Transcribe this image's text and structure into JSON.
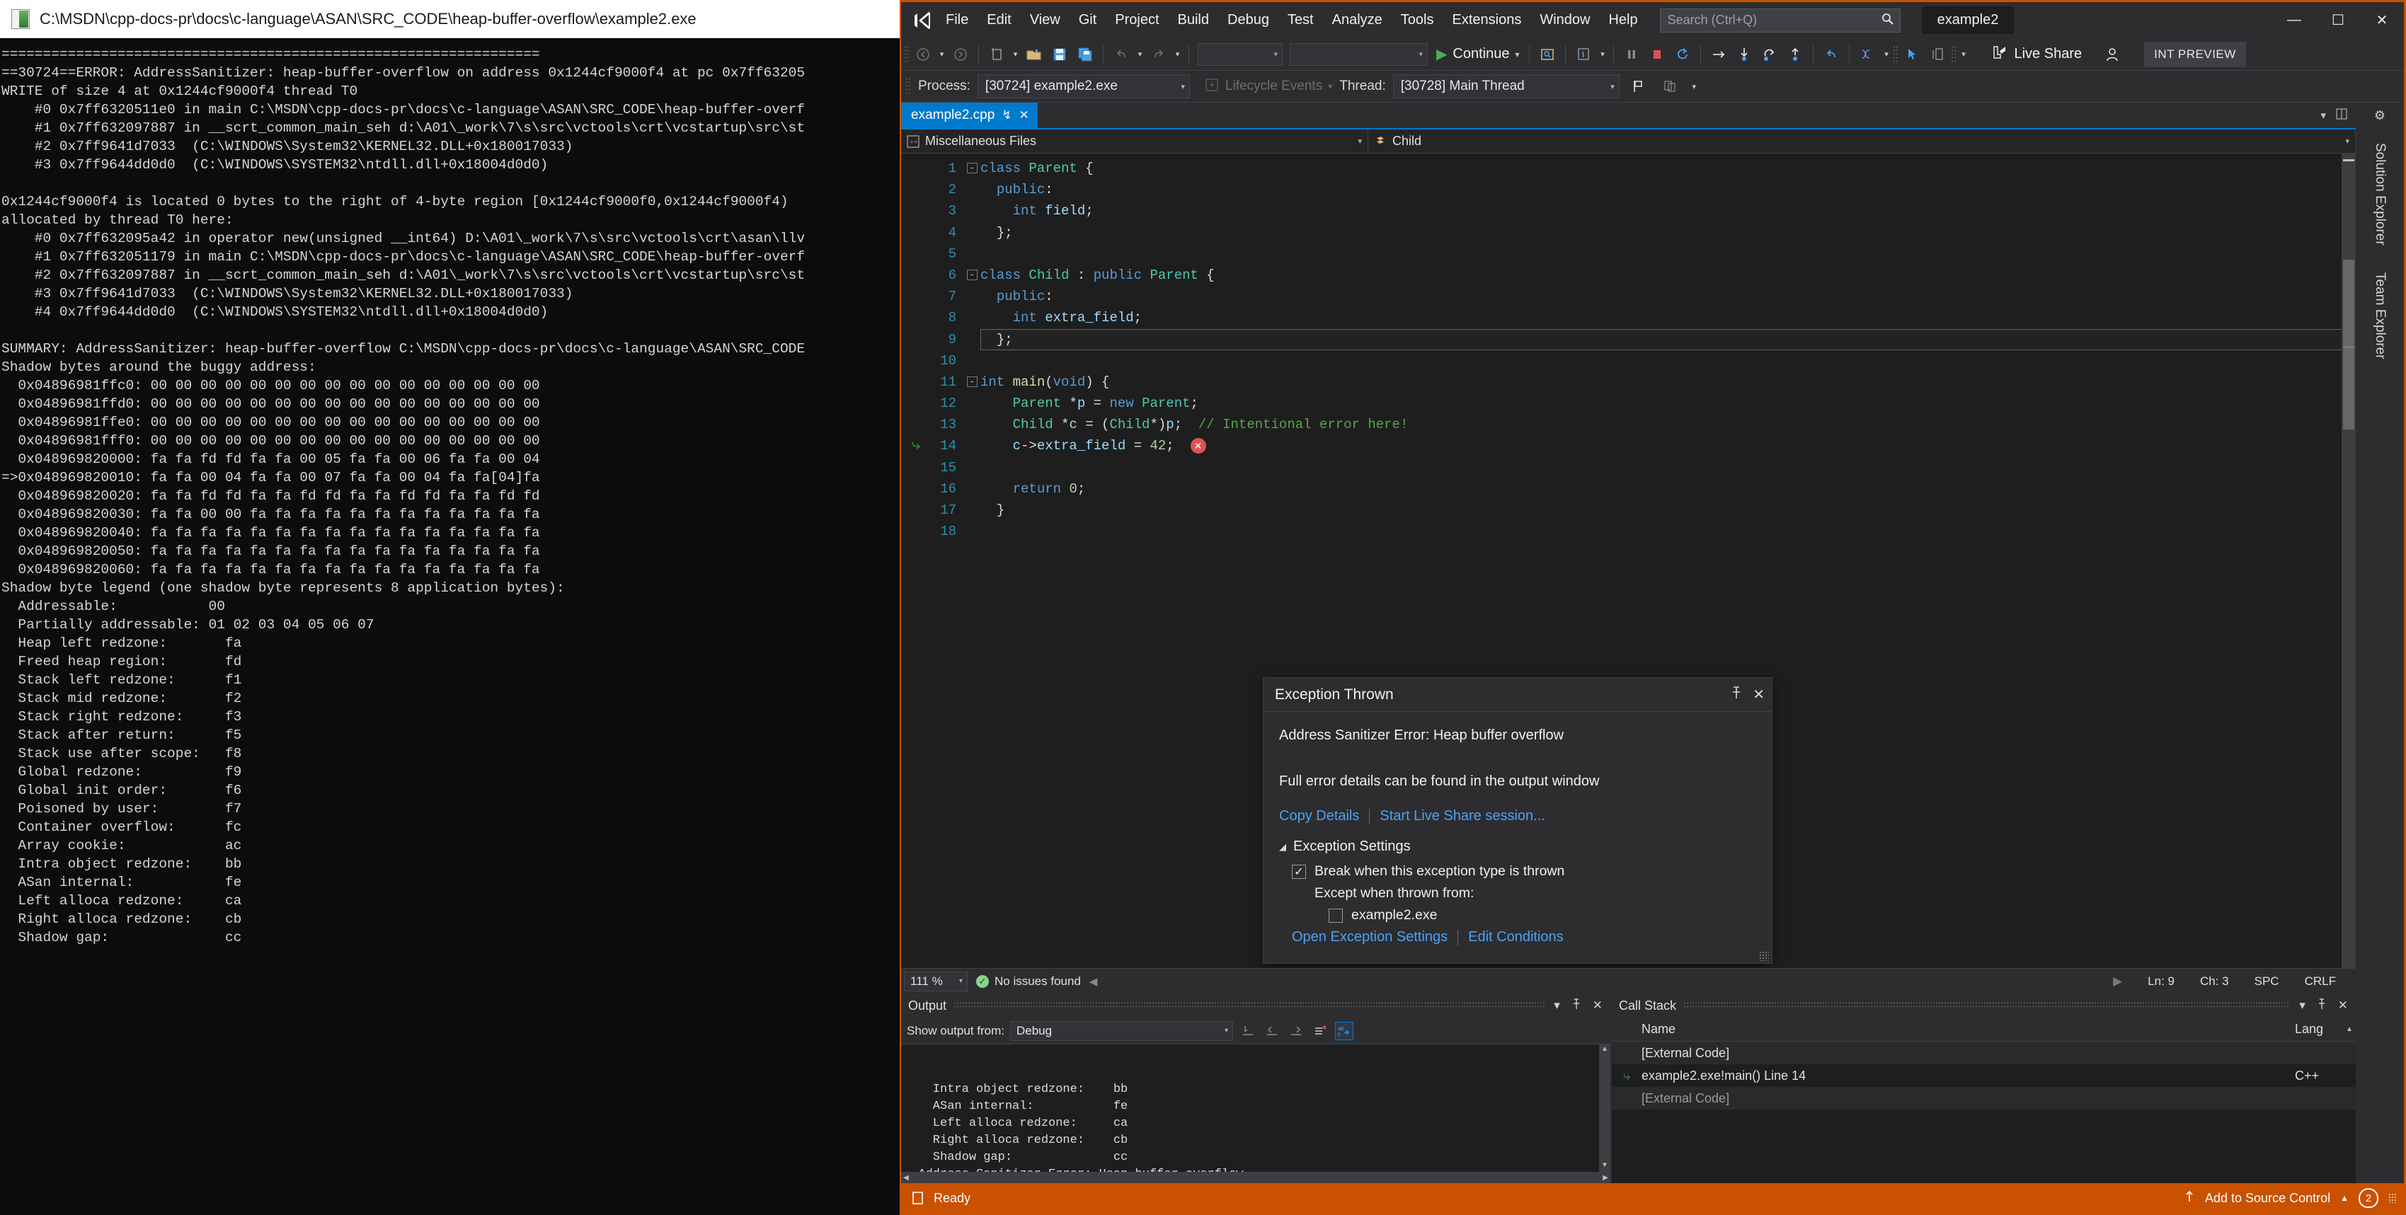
{
  "console": {
    "title": "C:\\MSDN\\cpp-docs-pr\\docs\\c-language\\ASAN\\SRC_CODE\\heap-buffer-overflow\\example2.exe",
    "icon": "cmd-prompt-icon",
    "lines": [
      "=================================================================",
      "==30724==ERROR: AddressSanitizer: heap-buffer-overflow on address 0x1244cf9000f4 at pc 0x7ff63205",
      "WRITE of size 4 at 0x1244cf9000f4 thread T0",
      "    #0 0x7ff6320511e0 in main C:\\MSDN\\cpp-docs-pr\\docs\\c-language\\ASAN\\SRC_CODE\\heap-buffer-overf",
      "    #1 0x7ff632097887 in __scrt_common_main_seh d:\\A01\\_work\\7\\s\\src\\vctools\\crt\\vcstartup\\src\\st",
      "    #2 0x7ff9641d7033  (C:\\WINDOWS\\System32\\KERNEL32.DLL+0x180017033)",
      "    #3 0x7ff9644dd0d0  (C:\\WINDOWS\\SYSTEM32\\ntdll.dll+0x18004d0d0)",
      "",
      "0x1244cf9000f4 is located 0 bytes to the right of 4-byte region [0x1244cf9000f0,0x1244cf9000f4)",
      "allocated by thread T0 here:",
      "    #0 0x7ff632095a42 in operator new(unsigned __int64) D:\\A01\\_work\\7\\s\\src\\vctools\\crt\\asan\\llv",
      "    #1 0x7ff632051179 in main C:\\MSDN\\cpp-docs-pr\\docs\\c-language\\ASAN\\SRC_CODE\\heap-buffer-overf",
      "    #2 0x7ff632097887 in __scrt_common_main_seh d:\\A01\\_work\\7\\s\\src\\vctools\\crt\\vcstartup\\src\\st",
      "    #3 0x7ff9641d7033  (C:\\WINDOWS\\System32\\KERNEL32.DLL+0x180017033)",
      "    #4 0x7ff9644dd0d0  (C:\\WINDOWS\\SYSTEM32\\ntdll.dll+0x18004d0d0)",
      "",
      "SUMMARY: AddressSanitizer: heap-buffer-overflow C:\\MSDN\\cpp-docs-pr\\docs\\c-language\\ASAN\\SRC_CODE",
      "Shadow bytes around the buggy address:",
      "  0x04896981ffc0: 00 00 00 00 00 00 00 00 00 00 00 00 00 00 00 00",
      "  0x04896981ffd0: 00 00 00 00 00 00 00 00 00 00 00 00 00 00 00 00",
      "  0x04896981ffe0: 00 00 00 00 00 00 00 00 00 00 00 00 00 00 00 00",
      "  0x04896981fff0: 00 00 00 00 00 00 00 00 00 00 00 00 00 00 00 00",
      "  0x048969820000: fa fa fd fd fa fa 00 05 fa fa 00 06 fa fa 00 04",
      "=>0x048969820010: fa fa 00 04 fa fa 00 07 fa fa 00 04 fa fa[04]fa",
      "  0x048969820020: fa fa fd fd fa fa fd fd fa fa fd fd fa fa fd fd",
      "  0x048969820030: fa fa 00 00 fa fa fa fa fa fa fa fa fa fa fa fa",
      "  0x048969820040: fa fa fa fa fa fa fa fa fa fa fa fa fa fa fa fa",
      "  0x048969820050: fa fa fa fa fa fa fa fa fa fa fa fa fa fa fa fa",
      "  0x048969820060: fa fa fa fa fa fa fa fa fa fa fa fa fa fa fa fa",
      "Shadow byte legend (one shadow byte represents 8 application bytes):",
      "  Addressable:           00",
      "  Partially addressable: 01 02 03 04 05 06 07",
      "  Heap left redzone:       fa",
      "  Freed heap region:       fd",
      "  Stack left redzone:      f1",
      "  Stack mid redzone:       f2",
      "  Stack right redzone:     f3",
      "  Stack after return:      f5",
      "  Stack use after scope:   f8",
      "  Global redzone:          f9",
      "  Global init order:       f6",
      "  Poisoned by user:        f7",
      "  Container overflow:      fc",
      "  Array cookie:            ac",
      "  Intra object redzone:    bb",
      "  ASan internal:           fe",
      "  Left alloca redzone:     ca",
      "  Right alloca redzone:    cb",
      "  Shadow gap:              cc"
    ]
  },
  "vs": {
    "menu": [
      "File",
      "Edit",
      "View",
      "Git",
      "Project",
      "Build",
      "Debug",
      "Test",
      "Analyze",
      "Tools",
      "Extensions",
      "Window",
      "Help"
    ],
    "search": {
      "placeholder": "Search (Ctrl+Q)",
      "value": "",
      "icon": "search-icon"
    },
    "solution_name": "example2",
    "window_buttons": {
      "minimize": "—",
      "maximize": "☐",
      "close": "✕"
    },
    "toolbar": {
      "navigate_back": "←",
      "navigate_forward": "→",
      "new_item": "new-item-icon",
      "open_file": "open-file-icon",
      "save": "save-icon",
      "save_all": "save-all-icon",
      "undo": "↶",
      "redo": "↷",
      "combo1": "",
      "combo2": "",
      "continue_label": "Continue",
      "continue_icon": "play-icon",
      "break_all_icon": "pause-icon",
      "stop_icon": "stop-icon",
      "restart_icon": "restart-icon",
      "show_next_statement": "→",
      "step_into": "step-into-icon",
      "step_over": "step-over-icon",
      "step_out": "step-out-icon",
      "live_share_label": "Live Share",
      "int_preview_label": "INT PREVIEW"
    },
    "process_bar": {
      "process_label": "Process:",
      "process_value": "[30724] example2.exe",
      "lifecycle_label": "Lifecycle Events",
      "thread_label": "Thread:",
      "thread_value": "[30728] Main Thread"
    },
    "document_tab": {
      "label": "example2.cpp",
      "pin": "↯",
      "close": "✕"
    },
    "nav_bar": {
      "scope": "Miscellaneous Files",
      "member": "Child"
    },
    "editor": {
      "lines": [
        {
          "n": 1,
          "fold": "-",
          "tokens": [
            [
              "kw",
              "class"
            ],
            [
              "pun",
              " "
            ],
            [
              "type",
              "Parent"
            ],
            [
              "pun",
              " {"
            ]
          ]
        },
        {
          "n": 2,
          "fold": "",
          "tokens": [
            [
              "pun",
              "  "
            ],
            [
              "kw",
              "public"
            ],
            [
              "pun",
              ":"
            ]
          ]
        },
        {
          "n": 3,
          "fold": "",
          "tokens": [
            [
              "pun",
              "    "
            ],
            [
              "kw",
              "int"
            ],
            [
              "pun",
              " "
            ],
            [
              "var",
              "field"
            ],
            [
              "pun",
              ";"
            ]
          ]
        },
        {
          "n": 4,
          "fold": "",
          "tokens": [
            [
              "pun",
              "  };"
            ]
          ]
        },
        {
          "n": 5,
          "fold": "",
          "tokens": []
        },
        {
          "n": 6,
          "fold": "-",
          "tokens": [
            [
              "kw",
              "class"
            ],
            [
              "pun",
              " "
            ],
            [
              "type",
              "Child"
            ],
            [
              "pun",
              " : "
            ],
            [
              "kw",
              "public"
            ],
            [
              "pun",
              " "
            ],
            [
              "type",
              "Parent"
            ],
            [
              "pun",
              " {"
            ]
          ]
        },
        {
          "n": 7,
          "fold": "",
          "tokens": [
            [
              "pun",
              "  "
            ],
            [
              "kw",
              "public"
            ],
            [
              "pun",
              ":"
            ]
          ]
        },
        {
          "n": 8,
          "fold": "",
          "tokens": [
            [
              "pun",
              "    "
            ],
            [
              "kw",
              "int"
            ],
            [
              "pun",
              " "
            ],
            [
              "var",
              "extra_field"
            ],
            [
              "pun",
              ";"
            ]
          ]
        },
        {
          "n": 9,
          "fold": "",
          "tokens": [
            [
              "pun",
              "  };"
            ]
          ]
        },
        {
          "n": 10,
          "fold": "",
          "tokens": []
        },
        {
          "n": 11,
          "fold": "-",
          "tokens": [
            [
              "kw",
              "int"
            ],
            [
              "pun",
              " "
            ],
            [
              "fn",
              "main"
            ],
            [
              "pun",
              "("
            ],
            [
              "kw",
              "void"
            ],
            [
              "pun",
              ") {"
            ]
          ]
        },
        {
          "n": 12,
          "fold": "",
          "tokens": [
            [
              "pun",
              "    "
            ],
            [
              "type",
              "Parent"
            ],
            [
              "pun",
              " *"
            ],
            [
              "var",
              "p"
            ],
            [
              "pun",
              " = "
            ],
            [
              "kw",
              "new"
            ],
            [
              "pun",
              " "
            ],
            [
              "type",
              "Parent"
            ],
            [
              "pun",
              ";"
            ]
          ]
        },
        {
          "n": 13,
          "fold": "",
          "tokens": [
            [
              "pun",
              "    "
            ],
            [
              "type",
              "Child"
            ],
            [
              "pun",
              " *"
            ],
            [
              "var",
              "c"
            ],
            [
              "pun",
              " = ("
            ],
            [
              "type",
              "Child"
            ],
            [
              "pun",
              "*)"
            ],
            [
              "var",
              "p"
            ],
            [
              "pun",
              ";  "
            ],
            [
              "cmt",
              "// Intentional error here!"
            ]
          ]
        },
        {
          "n": 14,
          "fold": "",
          "tokens": [
            [
              "pun",
              "    "
            ],
            [
              "var",
              "c"
            ],
            [
              "pun",
              "->"
            ],
            [
              "var",
              "extra_field"
            ],
            [
              "pun",
              " = "
            ],
            [
              "num",
              "42"
            ],
            [
              "pun",
              ";  "
            ]
          ]
        },
        {
          "n": 15,
          "fold": "",
          "tokens": []
        },
        {
          "n": 16,
          "fold": "",
          "tokens": [
            [
              "pun",
              "    "
            ],
            [
              "kw",
              "return"
            ],
            [
              "pun",
              " "
            ],
            [
              "num",
              "0"
            ],
            [
              "pun",
              ";"
            ]
          ]
        },
        {
          "n": 17,
          "fold": "",
          "tokens": [
            [
              "pun",
              "  }"
            ]
          ]
        },
        {
          "n": 18,
          "fold": "",
          "tokens": []
        }
      ],
      "current_line": 14,
      "cursor_line": 9,
      "error_marker": "error-icon",
      "statement_arrow": "current-statement-arrow"
    },
    "exception_popup": {
      "title": "Exception Thrown",
      "pin_icon": "pin-icon",
      "close_icon": "close-icon",
      "message": "Address Sanitizer Error: Heap buffer overflow",
      "detail": "Full error details can be found in the output window",
      "copy_details_link": "Copy Details",
      "live_share_link": "Start Live Share session...",
      "settings_header": "Exception Settings",
      "break_checkbox_label": "Break when this exception type is thrown",
      "break_checked": true,
      "except_label": "Except when thrown from:",
      "except_item_label": "example2.exe",
      "except_item_checked": false,
      "open_settings_link": "Open Exception Settings",
      "edit_conditions_link": "Edit Conditions"
    },
    "editor_status": {
      "zoom": "111 %",
      "issues": "No issues found",
      "line": "Ln: 9",
      "char": "Ch: 3",
      "spaces": "SPC",
      "eol": "CRLF"
    },
    "output_pane": {
      "title": "Output",
      "show_output_from_label": "Show output from:",
      "show_output_from_value": "Debug",
      "lines": [
        "    Intra object redzone:    bb",
        "    ASan internal:           fe",
        "    Left alloca redzone:     ca",
        "    Right alloca redzone:    cb",
        "    Shadow gap:              cc",
        "  Address Sanitizer Error: Heap buffer overflow"
      ]
    },
    "call_stack_pane": {
      "title": "Call Stack",
      "columns": [
        "Name",
        "Lang"
      ],
      "rows": [
        {
          "name": "[External Code]",
          "lang": "",
          "current": false,
          "dim": false
        },
        {
          "name": "example2.exe!main() Line 14",
          "lang": "C++",
          "current": true,
          "dim": false
        },
        {
          "name": "[External Code]",
          "lang": "",
          "current": false,
          "dim": true
        }
      ]
    },
    "right_rail": [
      "Solution Explorer",
      "Team Explorer"
    ],
    "status_bar": {
      "state": "Ready",
      "source_control": "Add to Source Control",
      "notifications": "2"
    },
    "colors": {
      "accent_orange": "#ca5100",
      "tab_blue": "#007acc",
      "editor_bg": "#1e1e1e",
      "chrome_bg": "#2d2d30"
    }
  }
}
